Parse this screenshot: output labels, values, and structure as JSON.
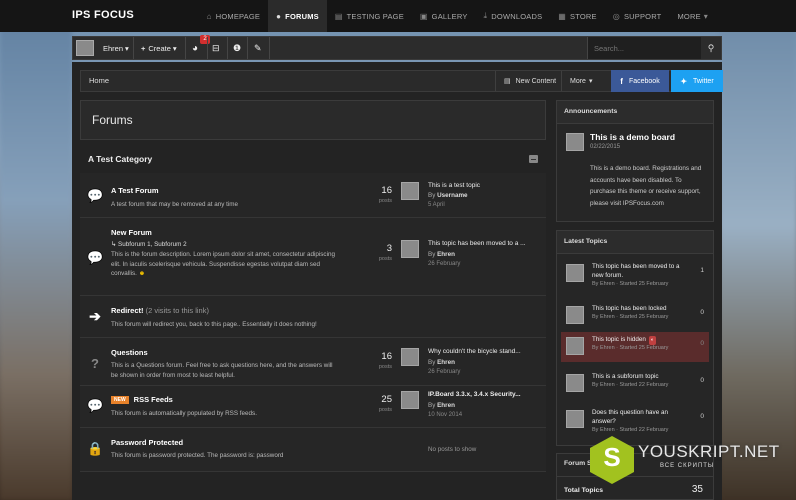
{
  "topnav": {
    "logo": "IPS FOCUS",
    "items": [
      {
        "label": "HOMEPAGE",
        "icon": "home-icon"
      },
      {
        "label": "FORUMS",
        "icon": "chat-icon",
        "active": true
      },
      {
        "label": "TESTING PAGE",
        "icon": "page-icon"
      },
      {
        "label": "GALLERY",
        "icon": "image-icon"
      },
      {
        "label": "DOWNLOADS",
        "icon": "download-icon"
      },
      {
        "label": "STORE",
        "icon": "cart-icon"
      },
      {
        "label": "SUPPORT",
        "icon": "lifebuoy-icon"
      },
      {
        "label": "MORE",
        "icon": "chevron-down-icon"
      }
    ]
  },
  "userbar": {
    "username": "Ehren",
    "create_label": "Create",
    "notification_count": "2",
    "search_placeholder": "Search..."
  },
  "breadcrumb": {
    "home": "Home",
    "new_content": "New Content",
    "more": "More",
    "facebook": "Facebook",
    "twitter": "Twitter"
  },
  "page_title": "Forums",
  "category": {
    "title": "A Test Category"
  },
  "forums": [
    {
      "name": "A Test Forum",
      "desc": "A test forum that may be removed at any time",
      "count": "16",
      "count_label": "posts",
      "last_title": "This is a test topic",
      "last_by_prefix": "By",
      "last_by": "Username",
      "last_date": "5 April"
    },
    {
      "name": "New Forum",
      "subforums": "Subforum 1,  Subforum 2",
      "desc": "This is the forum description. Lorem ipsum dolor sit amet, consectetur adipiscing elit. In iaculis scelerisque vehicula. Suspendisse egestas volutpat diam sed convallis.",
      "count": "3",
      "count_label": "posts",
      "last_title": "This topic has been moved to a ...",
      "last_by_prefix": "By",
      "last_by": "Ehren",
      "last_date": "26 February"
    },
    {
      "name": "Redirect!",
      "redirect_note": "(2 visits to this link)",
      "desc": "This forum will redirect you, back to this page.. Essentially it does nothing!"
    },
    {
      "name": "Questions",
      "desc": "This is a Questions forum. Feel free to ask questions here, and the answers will be shown in order from most to least helpful.",
      "count": "16",
      "count_label": "posts",
      "last_title": "Why couldn't the bicycle stand...",
      "last_by_prefix": "By",
      "last_by": "Ehren",
      "last_date": "26 February"
    },
    {
      "name": "RSS Feeds",
      "tag": "NEW",
      "desc": "This forum is automatically populated by RSS feeds.",
      "count": "25",
      "count_label": "posts",
      "last_title": "IP.Board 3.3.x, 3.4.x Security...",
      "last_by_prefix": "By",
      "last_by": "Ehren",
      "last_date": "10 Nov 2014"
    },
    {
      "name": "Password Protected",
      "desc": "This forum is password protected. The password is: password",
      "no_posts": "No posts to show"
    }
  ],
  "announcements": {
    "heading": "Announcements",
    "title": "This is a demo board",
    "date": "02/22/2015",
    "body": "This is a demo board. Registrations and accounts have been disabled. To purchase this theme or receive support, please visit IPSFocus.com"
  },
  "latest_topics": {
    "heading": "Latest Topics",
    "items": [
      {
        "title": "This topic has been moved to a new forum.",
        "meta": "By Ehren · Started 25 February",
        "count": "1"
      },
      {
        "title": "This topic has been locked",
        "meta": "By Ehren · Started 25 February",
        "count": "0"
      },
      {
        "title": "This topic is hidden",
        "meta": "By Ehren · Started 25 February",
        "count": "0",
        "highlight": true
      },
      {
        "title": "This is a subforum topic",
        "meta": "By Ehren · Started 22 February",
        "count": "0"
      },
      {
        "title": "Does this question have an answer?",
        "meta": "By Ehren · Started 22 February",
        "count": "0"
      }
    ]
  },
  "stats": {
    "heading": "Forum S",
    "total_topics_label": "Total Topics",
    "total_topics": "35"
  },
  "watermark": {
    "letter": "S",
    "text": "YOUSKRIPT.NET",
    "sub": "ВСЕ СКРИПТЫ"
  },
  "colors": {
    "facebook": "#3b5998",
    "twitter": "#1da1f2",
    "badge": "#d32f2f",
    "new_tag": "#e8822a",
    "highlight": "#5a2c2c"
  }
}
